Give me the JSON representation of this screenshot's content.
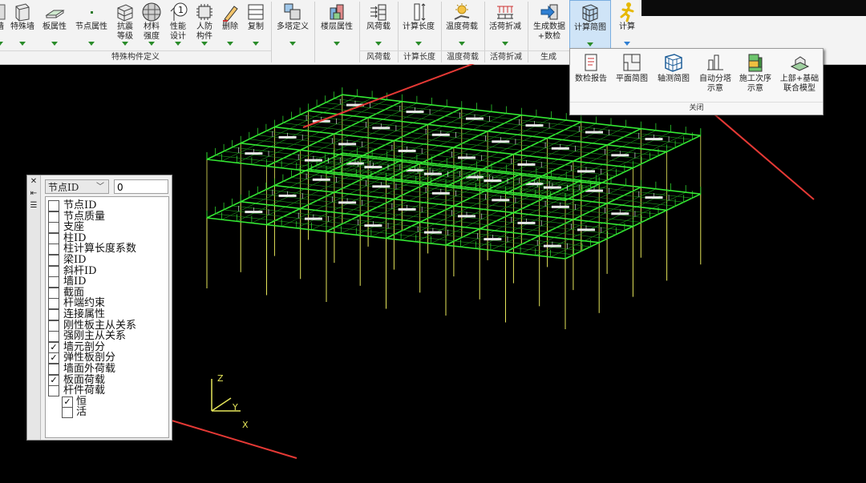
{
  "ribbon": {
    "buttons": [
      {
        "id": "wall-edge",
        "label": "墙"
      },
      {
        "id": "special-wall",
        "label": "特殊墙"
      },
      {
        "id": "slab-attr",
        "label": "板属性"
      },
      {
        "id": "node-attr",
        "label": "节点属性"
      },
      {
        "id": "seismic-level",
        "label": "抗震\n等级"
      },
      {
        "id": "material-strength",
        "label": "材料\n强度"
      },
      {
        "id": "performance-design",
        "label": "性能\n设计"
      },
      {
        "id": "civil-defense",
        "label": "人防\n构件"
      },
      {
        "id": "delete",
        "label": "删除"
      },
      {
        "id": "copy",
        "label": "复制"
      },
      {
        "id": "multi-tower",
        "label": "多塔定义"
      },
      {
        "id": "floor-attr",
        "label": "楼层属性"
      },
      {
        "id": "wind-load",
        "label": "风荷载"
      },
      {
        "id": "calc-length",
        "label": "计算长度"
      },
      {
        "id": "temperature-load",
        "label": "温度荷载"
      },
      {
        "id": "live-load-reduce",
        "label": "活荷折减"
      },
      {
        "id": "gen-data",
        "label": "生成数据\n+数检"
      },
      {
        "id": "calc-sketch",
        "label": "计算简图"
      },
      {
        "id": "calculate",
        "label": "计算"
      }
    ],
    "groups": {
      "special_members": "特殊构件定义",
      "wind_load": "风荷载",
      "calc_length": "计算长度",
      "temperature_load": "温度荷载",
      "live_load_reduce": "活荷折减",
      "generate": "生成"
    }
  },
  "dropdown": {
    "items": [
      {
        "id": "check-report",
        "label": "数检报告"
      },
      {
        "id": "plan-sketch",
        "label": "平面简图"
      },
      {
        "id": "axis-sketch",
        "label": "轴测简图"
      },
      {
        "id": "auto-tower",
        "label": "自动分塔\n示意"
      },
      {
        "id": "construction-seq",
        "label": "施工次序\n示意"
      },
      {
        "id": "upper-foundation",
        "label": "上部+基础\n联合模型"
      }
    ],
    "footer": "关闭"
  },
  "panel": {
    "combo_value": "节点ID",
    "number_value": "0",
    "options": [
      {
        "label": "节点ID",
        "checked": false
      },
      {
        "label": "节点质量",
        "checked": false
      },
      {
        "label": "支座",
        "checked": false
      },
      {
        "label": "柱ID",
        "checked": false
      },
      {
        "label": "柱计算长度系数",
        "checked": false
      },
      {
        "label": "梁ID",
        "checked": false
      },
      {
        "label": "斜杆ID",
        "checked": false
      },
      {
        "label": "墙ID",
        "checked": false
      },
      {
        "label": "截面",
        "checked": false
      },
      {
        "label": "杆端约束",
        "checked": false
      },
      {
        "label": "连接属性",
        "checked": false
      },
      {
        "label": "刚性板主从关系",
        "checked": false
      },
      {
        "label": "强刚主从关系",
        "checked": false
      },
      {
        "label": "墙元剖分",
        "checked": true
      },
      {
        "label": "弹性板剖分",
        "checked": true
      },
      {
        "label": "墙面外荷载",
        "checked": false
      },
      {
        "label": "板面荷载",
        "checked": true
      },
      {
        "label": "杆件荷载",
        "checked": false
      }
    ],
    "sub_options": [
      {
        "label": "恒",
        "checked": true
      },
      {
        "label": "活",
        "checked": false
      }
    ]
  },
  "viewport": {
    "axis_x": "X",
    "axis_y": "Y",
    "axis_z": "Z",
    "colors": {
      "beam": "#33e833",
      "column": "#e6e65a",
      "background": "#000000",
      "arrow": "#e53935"
    }
  }
}
